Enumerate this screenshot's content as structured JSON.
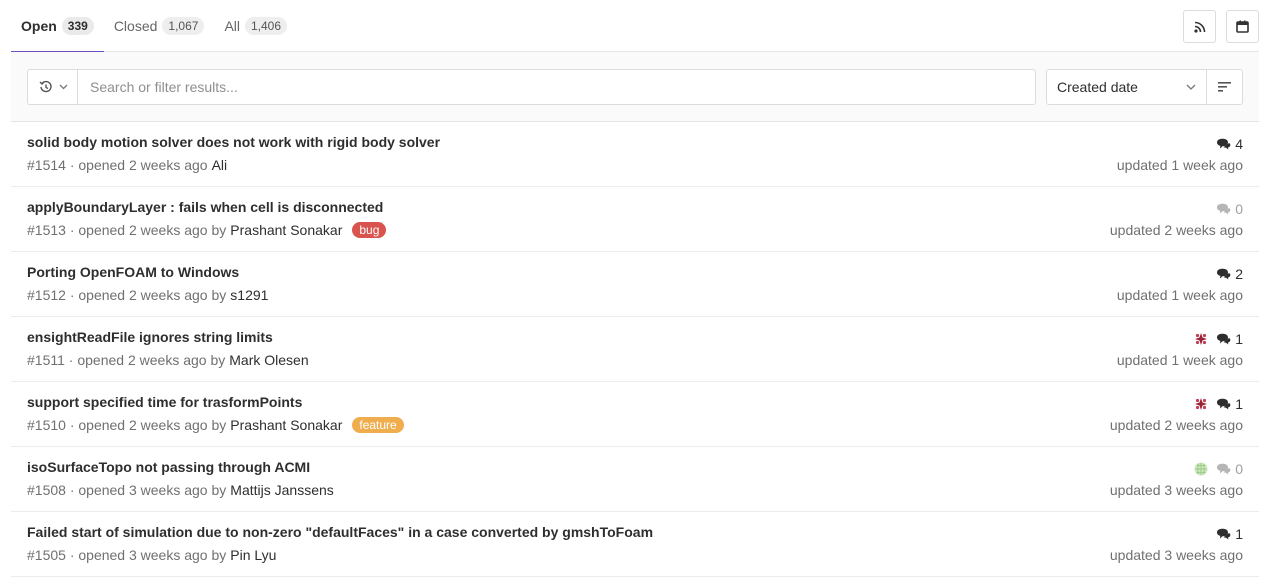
{
  "tabs": [
    {
      "label": "Open",
      "count": "339"
    },
    {
      "label": "Closed",
      "count": "1,067"
    },
    {
      "label": "All",
      "count": "1,406"
    }
  ],
  "actions": {
    "rss_icon": "rss-icon",
    "calendar_icon": "calendar-icon"
  },
  "filter": {
    "placeholder": "Search or filter results...",
    "history_icon": "history-icon",
    "sort_label": "Created date"
  },
  "colors": {
    "accent": "#6b4fbb",
    "label_bug": "#d9534f",
    "label_feature": "#f0ad4e"
  },
  "issues": [
    {
      "title": "solid body motion solver does not work with rigid body solver",
      "number": "#1514",
      "opened": "· opened 2 weeks ago",
      "by": "",
      "author": "Ali",
      "label": "",
      "comments": "4",
      "updated": "updated 1 week ago",
      "avatar": ""
    },
    {
      "title": "applyBoundaryLayer : fails when cell is disconnected",
      "number": "#1513",
      "opened": "· opened 2 weeks ago",
      "by": "by",
      "author": "Prashant Sonakar",
      "label": "bug",
      "comments": "0",
      "updated": "updated 2 weeks ago",
      "avatar": ""
    },
    {
      "title": "Porting OpenFOAM to Windows",
      "number": "#1512",
      "opened": "· opened 2 weeks ago",
      "by": "by",
      "author": "s1291",
      "label": "",
      "comments": "2",
      "updated": "updated 1 week ago",
      "avatar": ""
    },
    {
      "title": "ensightReadFile ignores string limits",
      "number": "#1511",
      "opened": "· opened 2 weeks ago",
      "by": "by",
      "author": "Mark Olesen",
      "label": "",
      "comments": "1",
      "updated": "updated 1 week ago",
      "avatar": "red"
    },
    {
      "title": "support specified time for trasformPoints",
      "number": "#1510",
      "opened": "· opened 2 weeks ago",
      "by": "by",
      "author": "Prashant Sonakar",
      "label": "feature",
      "comments": "1",
      "updated": "updated 2 weeks ago",
      "avatar": "red"
    },
    {
      "title": "isoSurfaceTopo not passing through ACMI",
      "number": "#1508",
      "opened": "· opened 3 weeks ago",
      "by": "by",
      "author": "Mattijs Janssens",
      "label": "",
      "comments": "0",
      "updated": "updated 3 weeks ago",
      "avatar": "green"
    },
    {
      "title": "Failed start of simulation due to non-zero \"defaultFaces\" in a case converted by gmshToFoam",
      "number": "#1505",
      "opened": "· opened 3 weeks ago",
      "by": "by",
      "author": "Pin Lyu",
      "label": "",
      "comments": "1",
      "updated": "updated 3 weeks ago",
      "avatar": ""
    }
  ]
}
